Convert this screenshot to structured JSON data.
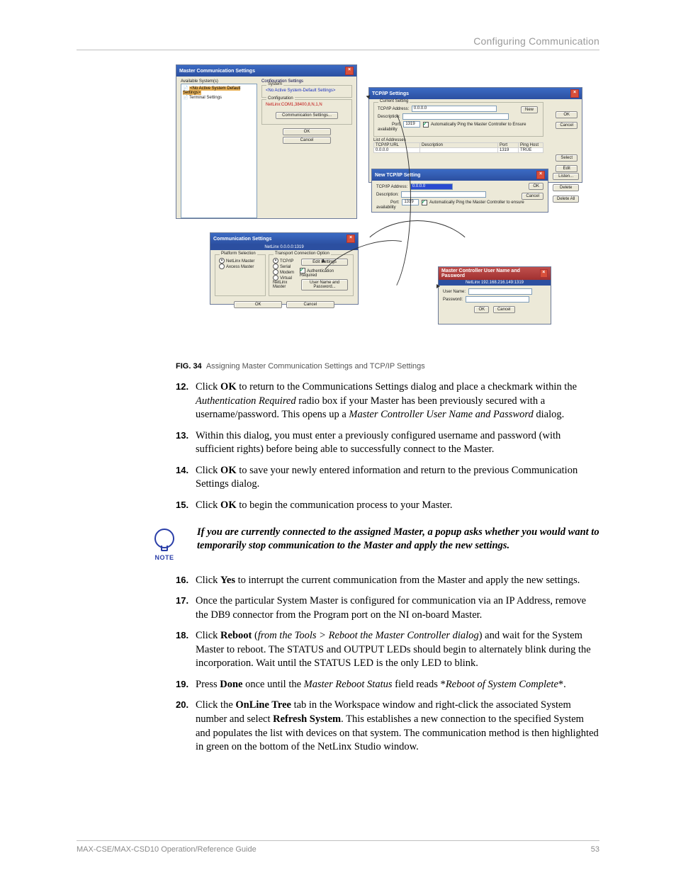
{
  "header": {
    "section": "Configuring Communication"
  },
  "fig": {
    "master_comm": {
      "title": "Master Communication Settings",
      "tree_header": "Available System(s)",
      "tree_items": [
        "<No Active System Default Settings>",
        "Terminal Settings"
      ],
      "cfg_settings_label": "Configuration Settings",
      "system_label": "System",
      "system_value": "<No Active System-Default Settings>",
      "config_label": "Configuration",
      "config_value": "NetLinx:COM1,38400,8,N,1,N",
      "comm_settings_btn": "Communication Settings...",
      "ok": "OK",
      "cancel": "Cancel"
    },
    "tcpip": {
      "title": "TCP/IP Settings",
      "current_group": "Current Setting",
      "addr_label": "TCP/IP Address:",
      "addr_value": "0.0.0.0",
      "desc_label": "Description:",
      "port_label": "Port:",
      "port_value": "1319",
      "auto_ping": "Automatically Ping the Master Controller to Ensure availability",
      "ok": "OK",
      "cancel": "Cancel",
      "new_btn": "New",
      "list_label": "List of Addresses",
      "cols": {
        "url": "TCP/IP:URL",
        "desc": "Description",
        "port": "Port",
        "ping": "Ping Host"
      },
      "row": {
        "url": "0.0.0.0",
        "desc": "",
        "port": "1319",
        "ping": "TRUE"
      },
      "side_buttons": [
        "Select",
        "Edit",
        "Listen...",
        "Delete",
        "Delete All"
      ]
    },
    "new_tcpip": {
      "title": "New TCP/IP Setting",
      "addr_label": "TCP/IP Address:",
      "addr_value": "0.0.0.0",
      "desc_label": "Description:",
      "port_label": "Port:",
      "port_value": "1319",
      "auto_ping": "Automatically Ping the Master Controller to ensure availability",
      "ok": "OK",
      "cancel": "Cancel"
    },
    "comm_settings": {
      "title": "Communication Settings",
      "banner": "NetLinx 0.0.0.0:1319",
      "platform_group": "Platform Selection",
      "platform_opts": [
        "NetLinx Master",
        "Axcess Master"
      ],
      "transport_group": "Transport Connection Option",
      "transport_opts": [
        "TCP/IP",
        "Serial",
        "Modem",
        "Virtual NetLinx Master"
      ],
      "edit_btn": "Edit Settings",
      "auth_chk": "Authentication Required",
      "user_btn": "User Name and Password...",
      "ok": "OK",
      "cancel": "Cancel"
    },
    "auth": {
      "title": "Master Controller User Name and Password",
      "banner": "NetLinx 192.168.216.149:1319",
      "user_label": "User Name:",
      "pass_label": "Password:",
      "ok": "OK",
      "cancel": "Cancel"
    }
  },
  "caption": {
    "figno": "FIG. 34",
    "text": "Assigning Master Communication Settings and TCP/IP Settings"
  },
  "steps_a": [
    {
      "n": "12.",
      "html": "Click <b>OK</b> to return to the Communications Settings dialog and place a checkmark within the <i>Authentication Required</i> radio box if your Master has been previously secured with a username/password. This opens up a <i>Master Controller User Name and Password</i> dialog."
    },
    {
      "n": "13.",
      "html": "Within this dialog, you must enter a previously configured username and password (with sufficient rights) before being able to successfully connect to the Master."
    },
    {
      "n": "14.",
      "html": "Click <b>OK</b> to save your newly entered information and return to the previous Communication Settings dialog."
    },
    {
      "n": "15.",
      "html": "Click <b>OK</b> to begin the communication process to your Master."
    }
  ],
  "note": {
    "label": "NOTE",
    "text": "If you are currently connected to the assigned Master, a popup asks whether you would want to temporarily stop communication to the Master and apply the new settings."
  },
  "steps_b": [
    {
      "n": "16.",
      "html": "Click <b>Yes</b> to interrupt the current communication from the Master and apply the new settings."
    },
    {
      "n": "17.",
      "html": "Once the particular System Master is configured for communication via an IP Address, remove the DB9 connector from the Program port on the NI on-board Master."
    },
    {
      "n": "18.",
      "html": "Click <b>Reboot</b> (<i>from the Tools &gt; Reboot the Master Controller dialog</i>) and wait for the System Master to reboot. The STATUS and OUTPUT LEDs should begin to alternately blink during the incorporation. Wait until the STATUS LED is the only LED to blink."
    },
    {
      "n": "19.",
      "html": "Press <b>Done</b> once until the <i>Master Reboot Status</i> field reads *<i>Reboot of System Complete</i>*."
    },
    {
      "n": "20.",
      "html": "Click the <b>OnLine Tree</b> tab in the Workspace window and right-click the associated System number and select <b>Refresh System</b>. This establishes a new connection to the specified System and populates the list with devices on that system. The communication method is then highlighted in green on the bottom of the NetLinx Studio window."
    }
  ],
  "footer": {
    "left": "MAX-CSE/MAX-CSD10 Operation/Reference Guide",
    "right": "53"
  }
}
